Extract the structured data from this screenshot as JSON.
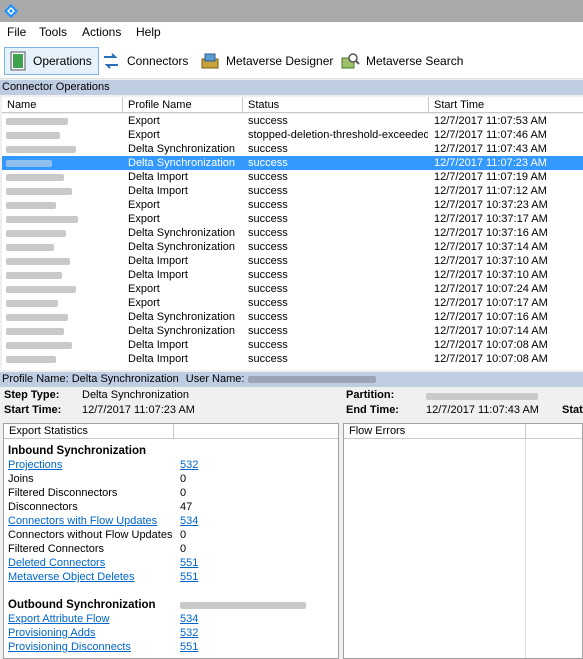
{
  "menu": [
    "File",
    "Tools",
    "Actions",
    "Help"
  ],
  "toolbar": {
    "operations": "Operations",
    "connectors": "Connectors",
    "metaverse_designer": "Metaverse Designer",
    "metaverse_search": "Metaverse Search"
  },
  "connector_operations": {
    "title": "Connector Operations",
    "columns": [
      "Name",
      "Profile Name",
      "Status",
      "Start Time"
    ],
    "rows": [
      {
        "profile": "Export",
        "status": "success",
        "start": "12/7/2017 11:07:53 AM",
        "selected": false
      },
      {
        "profile": "Export",
        "status": "stopped-deletion-threshold-exceeded",
        "start": "12/7/2017 11:07:46 AM",
        "selected": false
      },
      {
        "profile": "Delta Synchronization",
        "status": "success",
        "start": "12/7/2017 11:07:43 AM",
        "selected": false
      },
      {
        "profile": "Delta Synchronization",
        "status": "success",
        "start": "12/7/2017 11:07:23 AM",
        "selected": true
      },
      {
        "profile": "Delta Import",
        "status": "success",
        "start": "12/7/2017 11:07:19 AM",
        "selected": false
      },
      {
        "profile": "Delta Import",
        "status": "success",
        "start": "12/7/2017 11:07:12 AM",
        "selected": false
      },
      {
        "profile": "Export",
        "status": "success",
        "start": "12/7/2017 10:37:23 AM",
        "selected": false
      },
      {
        "profile": "Export",
        "status": "success",
        "start": "12/7/2017 10:37:17 AM",
        "selected": false
      },
      {
        "profile": "Delta Synchronization",
        "status": "success",
        "start": "12/7/2017 10:37:16 AM",
        "selected": false
      },
      {
        "profile": "Delta Synchronization",
        "status": "success",
        "start": "12/7/2017 10:37:14 AM",
        "selected": false
      },
      {
        "profile": "Delta Import",
        "status": "success",
        "start": "12/7/2017 10:37:10 AM",
        "selected": false
      },
      {
        "profile": "Delta Import",
        "status": "success",
        "start": "12/7/2017 10:37:10 AM",
        "selected": false
      },
      {
        "profile": "Export",
        "status": "success",
        "start": "12/7/2017 10:07:24 AM",
        "selected": false
      },
      {
        "profile": "Export",
        "status": "success",
        "start": "12/7/2017 10:07:17 AM",
        "selected": false
      },
      {
        "profile": "Delta Synchronization",
        "status": "success",
        "start": "12/7/2017 10:07:16 AM",
        "selected": false
      },
      {
        "profile": "Delta Synchronization",
        "status": "success",
        "start": "12/7/2017 10:07:14 AM",
        "selected": false
      },
      {
        "profile": "Delta Import",
        "status": "success",
        "start": "12/7/2017 10:07:08 AM",
        "selected": false
      },
      {
        "profile": "Delta Import",
        "status": "success",
        "start": "12/7/2017 10:07:08 AM",
        "selected": false
      }
    ]
  },
  "details": {
    "profile_label": "Profile Name:",
    "profile_value": "Delta Synchronization",
    "user_label": "User Name:",
    "step_type_label": "Step Type:",
    "step_type_value": "Delta Synchronization",
    "start_time_label": "Start Time:",
    "start_time_value": "12/7/2017 11:07:23 AM",
    "partition_label": "Partition:",
    "end_time_label": "End Time:",
    "end_time_value": "12/7/2017 11:07:43 AM",
    "status_label_cut": "Stat"
  },
  "export_statistics": {
    "header": "Export Statistics",
    "inbound_title": "Inbound Synchronization",
    "inbound": [
      {
        "label": "Projections",
        "value": "532",
        "link": true
      },
      {
        "label": "Joins",
        "value": "0",
        "link": false
      },
      {
        "label": "Filtered Disconnectors",
        "value": "0",
        "link": false
      },
      {
        "label": "Disconnectors",
        "value": "47",
        "link": false
      },
      {
        "label": "Connectors with Flow Updates",
        "value": "534",
        "link": true
      },
      {
        "label": "Connectors without Flow Updates",
        "value": "0",
        "link": false
      },
      {
        "label": "Filtered Connectors",
        "value": "0",
        "link": false
      },
      {
        "label": "Deleted Connectors",
        "value": "551",
        "link": true
      },
      {
        "label": "Metaverse Object Deletes",
        "value": "551",
        "link": true
      }
    ],
    "outbound_title": "Outbound Synchronization",
    "outbound": [
      {
        "label": "Export Attribute Flow",
        "value": "534",
        "link": true
      },
      {
        "label": "Provisioning Adds",
        "value": "532",
        "link": true
      },
      {
        "label": "Provisioning Disconnects",
        "value": "551",
        "link": true
      }
    ]
  },
  "flow_errors": {
    "header": "Flow Errors"
  }
}
